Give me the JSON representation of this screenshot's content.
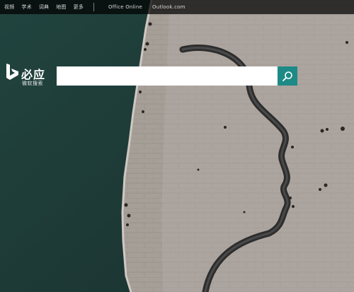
{
  "nav": {
    "items": [
      {
        "label": "视频"
      },
      {
        "label": "学术"
      },
      {
        "label": "词典"
      },
      {
        "label": "地图"
      },
      {
        "label": "更多"
      }
    ],
    "external": [
      {
        "label": "Office Online"
      },
      {
        "label": "Outlook.com"
      }
    ]
  },
  "logo": {
    "title": "必应",
    "subtitle": "微软搜索"
  },
  "search": {
    "value": "",
    "placeholder": ""
  },
  "colors": {
    "accent": "#1e8a86",
    "sea": "#1f3b38",
    "pavement": "#a39b94"
  },
  "icons": {
    "search_button": "search-icon",
    "logo": "bing-logo-icon"
  }
}
